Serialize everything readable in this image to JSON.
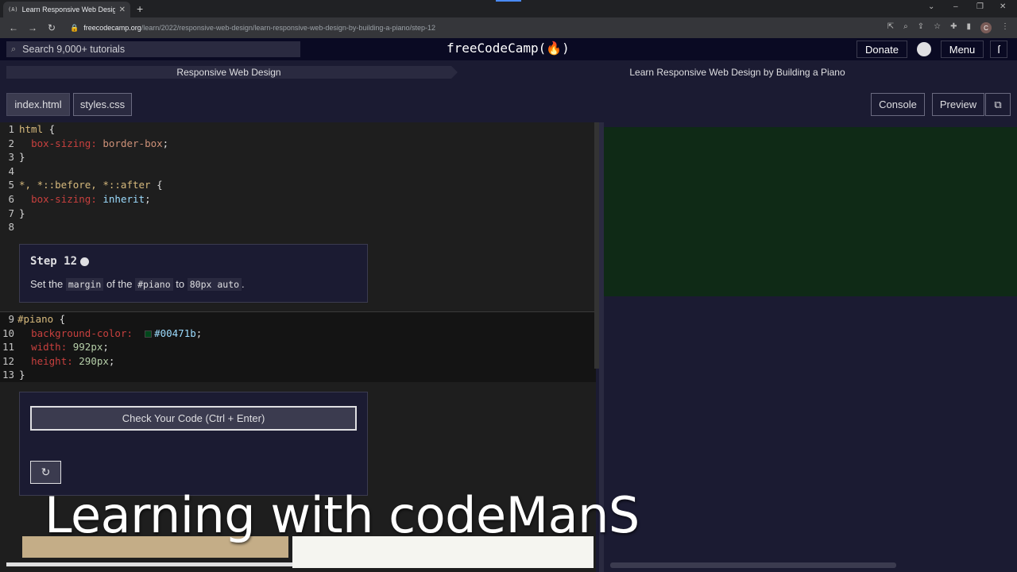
{
  "browser": {
    "tab_favicon": "(A)",
    "tab_title": "Learn Responsive Web Design by Building a Piano",
    "tab_close": "✕",
    "new_tab": "+",
    "url_host": "freecodecamp.org",
    "url_path": "/learn/2022/responsive-web-design/learn-responsive-web-design-by-building-a-piano/step-12",
    "avatar_letter": "C"
  },
  "nav": {
    "search_placeholder": "Search 9,000+ tutorials",
    "logo": "freeCodeCamp(🔥)",
    "donate": "Donate",
    "menu": "Menu"
  },
  "breadcrumb": {
    "superblock": "Responsive Web Design",
    "block": "Learn Responsive Web Design by Building a Piano"
  },
  "toolbar": {
    "files": [
      "index.html",
      "styles.css"
    ],
    "active_file": "styles.css",
    "console": "Console",
    "preview": "Preview"
  },
  "editor": {
    "line_numbers": [
      "1",
      "2",
      "3",
      "4",
      "5",
      "6",
      "7",
      "8",
      "9",
      "10",
      "11",
      "12",
      "13"
    ],
    "lines": {
      "l1_sel": "html",
      "l1_p": " {",
      "l2_prop": "box-sizing:",
      "l2_val": " border-box",
      "l2_p": ";",
      "l3_p": "}",
      "l5_sel": "*, *::before, *::after",
      "l5_p": " {",
      "l6_prop": "box-sizing:",
      "l6_val": " inherit",
      "l6_p": ";",
      "l7_p": "}",
      "l9_sel": "#piano",
      "l9_p": " {",
      "l10_prop": "background-color:",
      "l10_val": "#00471b",
      "l10_p": ";",
      "l11_prop": "width:",
      "l11_val": " 992px",
      "l11_p": ";",
      "l12_prop": "height:",
      "l12_val": " 290px",
      "l12_p": ";",
      "l13_p": "}"
    }
  },
  "step": {
    "title": "Step 12",
    "desc_1": "Set the ",
    "code_1": "margin",
    "desc_2": " of the ",
    "code_2": "#piano",
    "desc_3": " to ",
    "code_3": "80px auto",
    "desc_4": "."
  },
  "actions": {
    "check": "Check Your Code (Ctrl + Enter)",
    "reset_icon": "↻"
  },
  "preview_pane": {
    "piano_color": "#00471b"
  },
  "overlay": {
    "caption": "Learning with codeManS"
  }
}
